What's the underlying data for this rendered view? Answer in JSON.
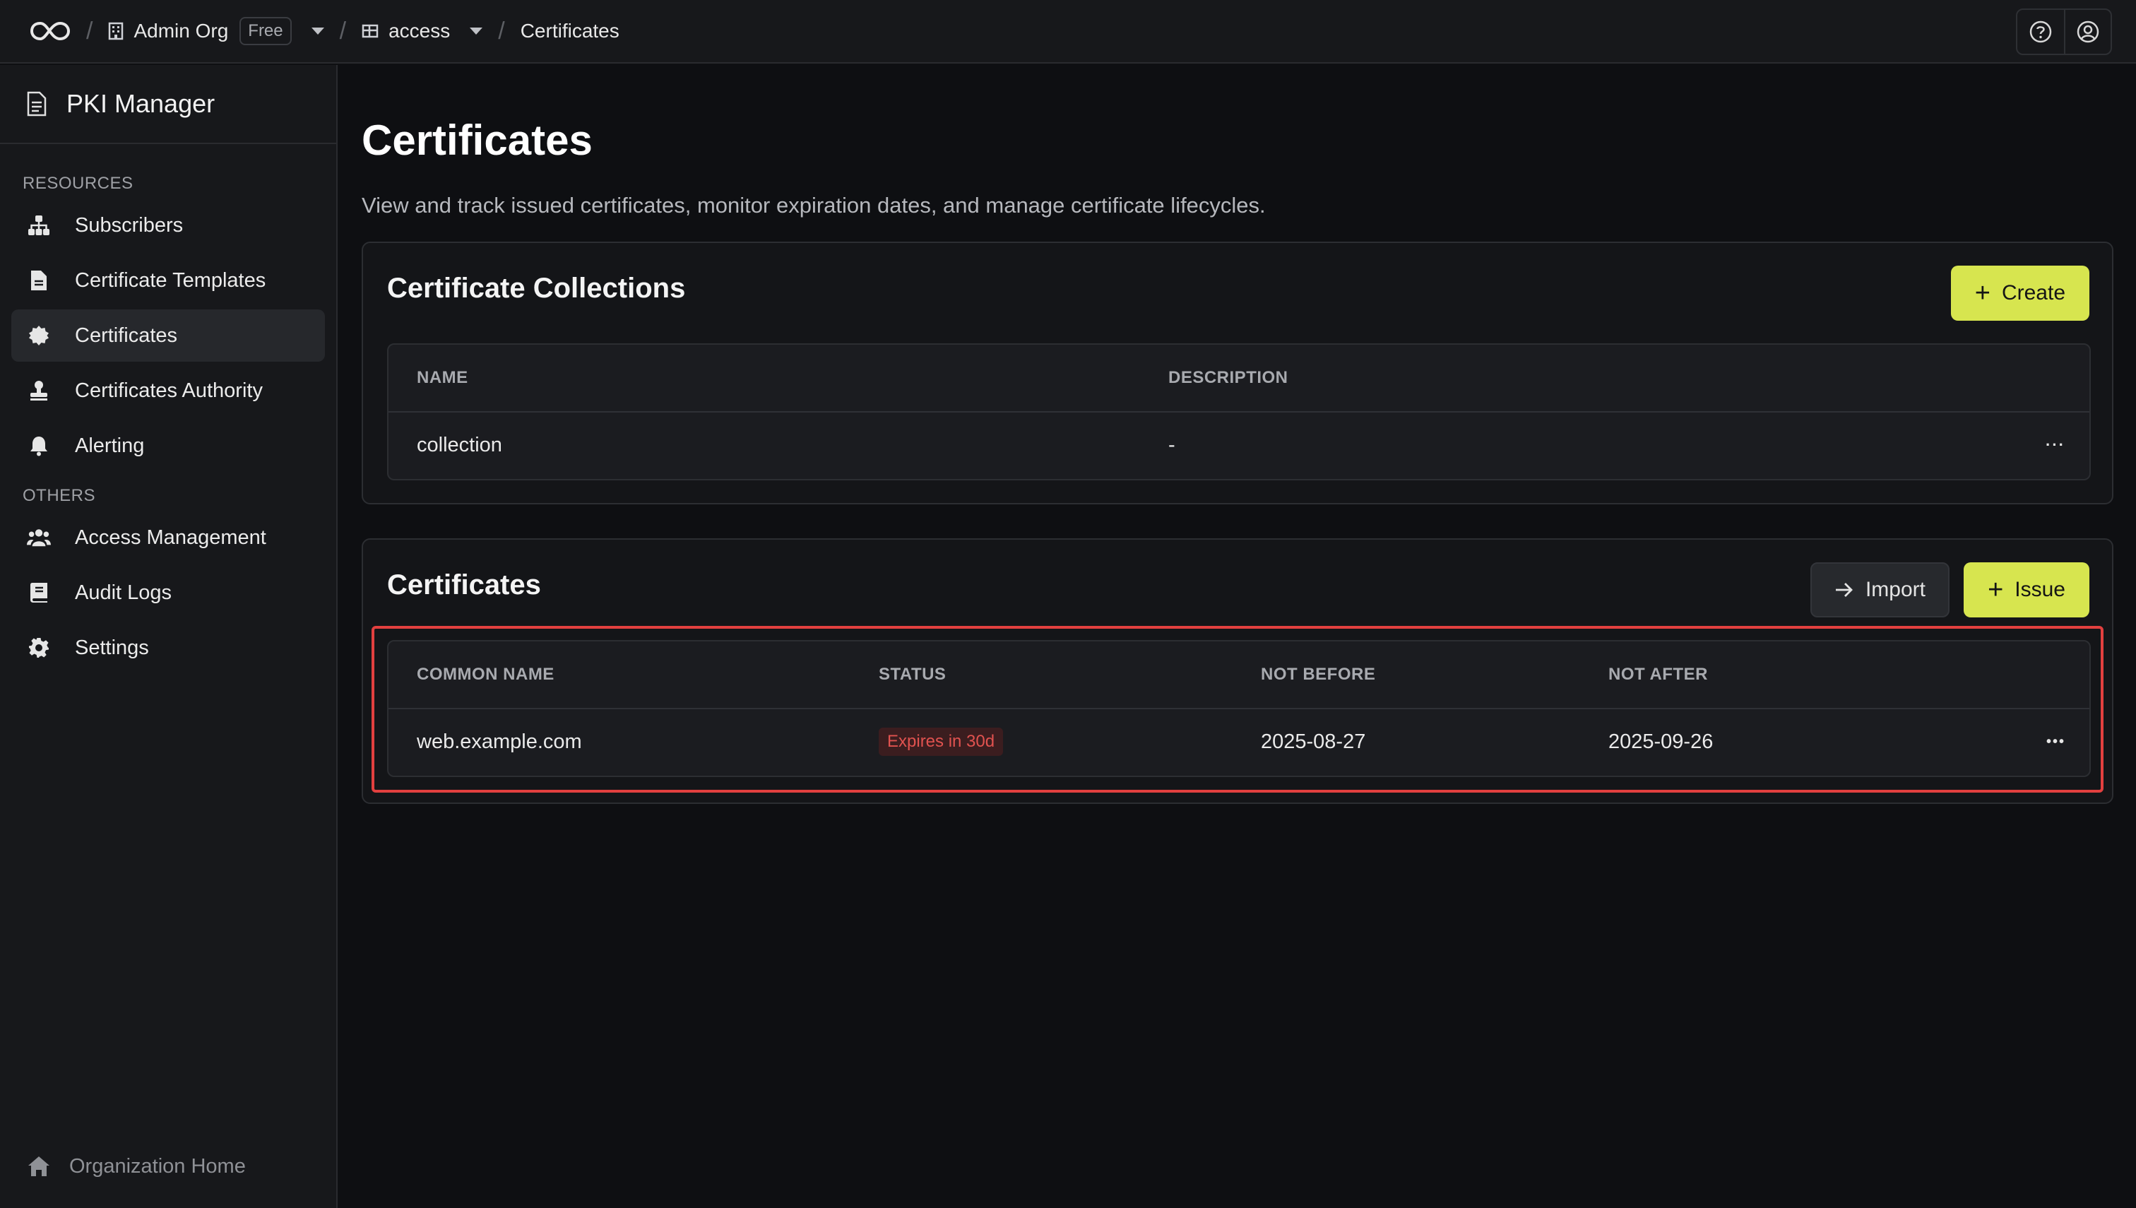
{
  "topbar": {
    "org_name": "Admin Org",
    "plan_badge": "Free",
    "project_name": "access",
    "current_page": "Certificates",
    "separator": "/"
  },
  "sidebar": {
    "app_title": "PKI Manager",
    "sections": [
      {
        "label": "RESOURCES",
        "items": [
          {
            "label": "Subscribers",
            "icon": "sitemap-icon"
          },
          {
            "label": "Certificate Templates",
            "icon": "file-icon"
          },
          {
            "label": "Certificates",
            "icon": "certificate-icon",
            "active": true
          },
          {
            "label": "Certificates Authority",
            "icon": "stamp-icon"
          },
          {
            "label": "Alerting",
            "icon": "bell-icon"
          }
        ]
      },
      {
        "label": "OTHERS",
        "items": [
          {
            "label": "Access Management",
            "icon": "users-icon"
          },
          {
            "label": "Audit Logs",
            "icon": "book-icon"
          },
          {
            "label": "Settings",
            "icon": "gear-icon"
          }
        ]
      }
    ],
    "footer_label": "Organization Home"
  },
  "main": {
    "title": "Certificates",
    "description": "View and track issued certificates, monitor expiration dates, and manage certificate lifecycles."
  },
  "collections": {
    "title": "Certificate Collections",
    "create_label": "Create",
    "columns": [
      "NAME",
      "DESCRIPTION"
    ],
    "rows": [
      {
        "name": "collection",
        "description": "-"
      }
    ],
    "row_menu": "···"
  },
  "certificates": {
    "title": "Certificates",
    "import_label": "Import",
    "issue_label": "Issue",
    "columns": [
      "COMMON NAME",
      "STATUS",
      "NOT BEFORE",
      "NOT AFTER"
    ],
    "rows": [
      {
        "common_name": "web.example.com",
        "status": "Expires in 30d",
        "not_before": "2025-08-27",
        "not_after": "2025-09-26"
      }
    ],
    "row_menu": "•••"
  },
  "colors": {
    "accent": "#d7e54f",
    "highlight": "#e2403f",
    "status_warning": "#e0524f"
  }
}
